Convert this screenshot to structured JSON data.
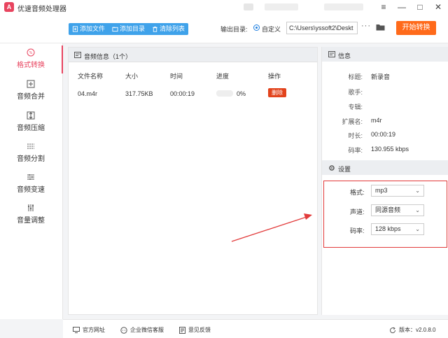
{
  "app": {
    "title": "优速音频处理器",
    "logo": "A"
  },
  "window": {
    "menu_icon": "≡",
    "minimize_icon": "—",
    "maximize_icon": "□",
    "close_icon": "✕"
  },
  "toolbar": {
    "add_file": "添加文件",
    "add_folder": "添加目录",
    "clear_list": "清除列表",
    "output_label": "输出目录:",
    "custom_label": "自定义",
    "output_path": "C:\\Users\\yssoft2\\Deskt",
    "more": "···",
    "start": "开始转换"
  },
  "sidebar": {
    "items": [
      {
        "label": "格式转换",
        "icon": "format-convert-icon"
      },
      {
        "label": "音频合并",
        "icon": "merge-icon"
      },
      {
        "label": "音频压缩",
        "icon": "compress-icon"
      },
      {
        "label": "音频分割",
        "icon": "split-icon"
      },
      {
        "label": "音频变速",
        "icon": "speed-icon"
      },
      {
        "label": "音量调整",
        "icon": "volume-adjust-icon"
      }
    ]
  },
  "file_panel": {
    "title": "音频信息（1个）",
    "columns": [
      "文件名称",
      "大小",
      "时间",
      "进度",
      "操作"
    ],
    "rows": [
      {
        "name": "04.m4r",
        "size": "317.75KB",
        "time": "00:00:19",
        "progress": "0%",
        "action": "删除"
      }
    ]
  },
  "info_panel": {
    "title": "信息",
    "fields": [
      {
        "key": "标题:",
        "value": "新录音"
      },
      {
        "key": "歌手:",
        "value": ""
      },
      {
        "key": "专辑:",
        "value": ""
      },
      {
        "key": "扩展名:",
        "value": "m4r"
      },
      {
        "key": "时长:",
        "value": "00:00:19"
      },
      {
        "key": "码率:",
        "value": "130.955 kbps"
      }
    ]
  },
  "settings_panel": {
    "title": "设置",
    "format_label": "格式:",
    "format_value": "mp3",
    "channel_label": "声道:",
    "channel_value": "同源音频",
    "bitrate_label": "码率:",
    "bitrate_value": "128 kbps"
  },
  "footer": {
    "website": "官方网址",
    "wechat": "企业微信客服",
    "feedback": "意见反馈",
    "version": "版本：v2.0.8.0"
  },
  "colors": {
    "accent": "#e8445f",
    "toolbar_blue": "#3fa2ea",
    "start_orange": "#ff6a1a",
    "delete_red": "#e2431c",
    "highlight_red": "#e23b3b"
  }
}
